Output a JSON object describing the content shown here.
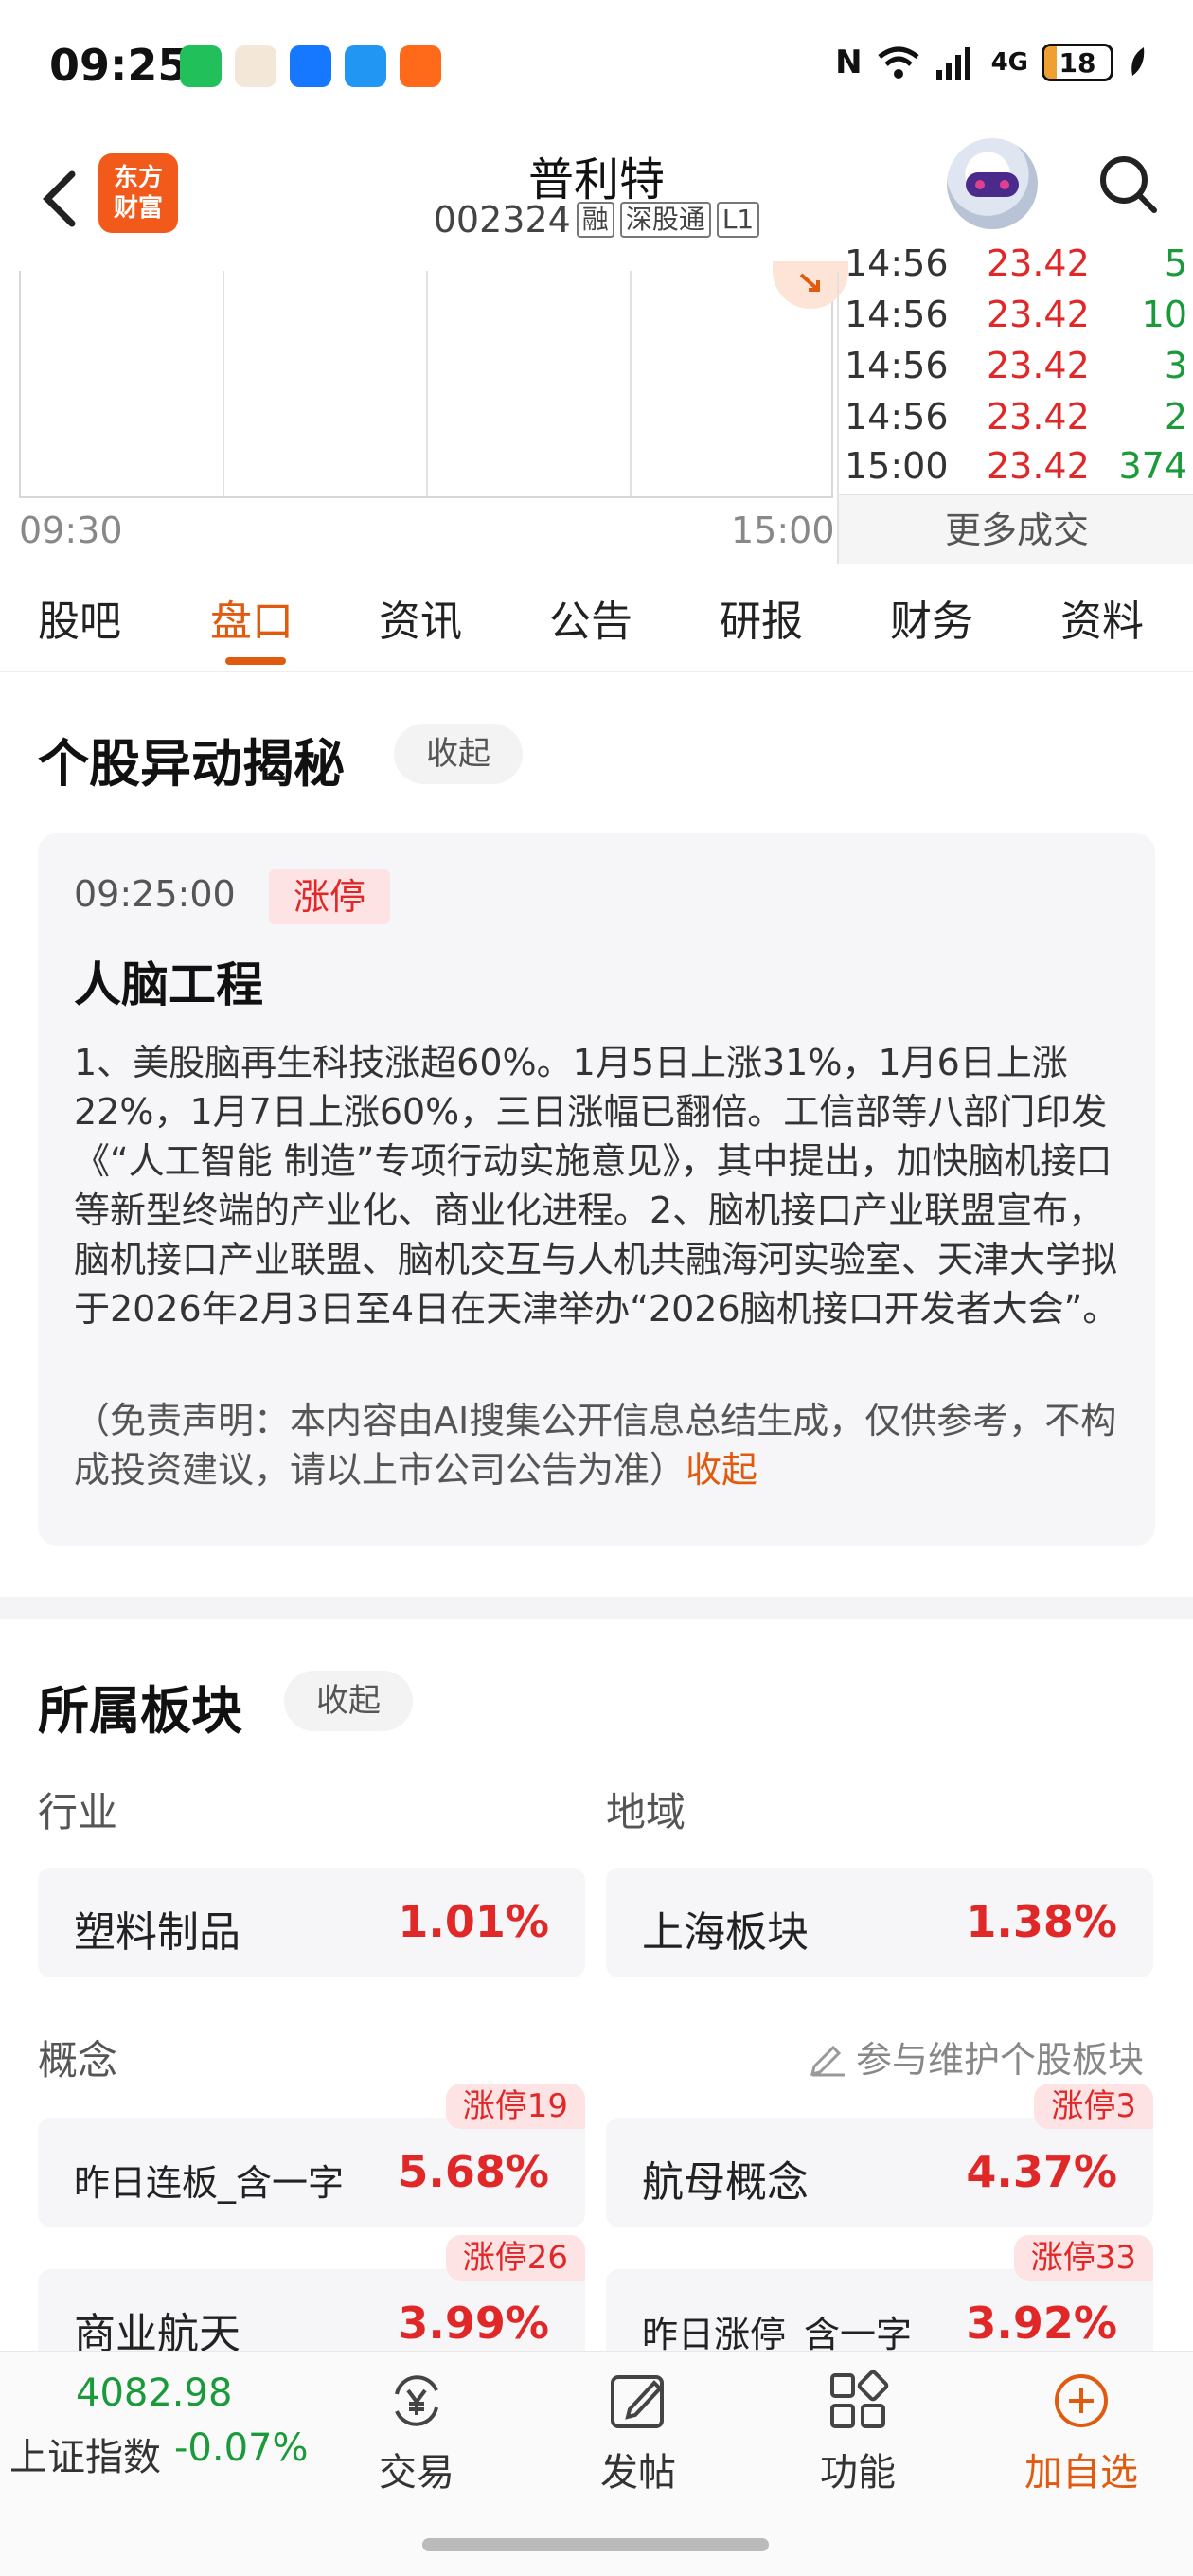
{
  "status_bar": {
    "time": "09:25",
    "battery": "18",
    "network": "4G",
    "battery_level": 0.18
  },
  "header": {
    "logo_text": [
      "东方",
      "财富"
    ],
    "stock_name": "普利特",
    "stock_code": "002324",
    "tags": [
      "融",
      "深股通",
      "L1"
    ]
  },
  "chart": {
    "start_label": "09:30",
    "end_label": "15:00"
  },
  "trades": {
    "rows": [
      {
        "time": "14:56",
        "price": "23.42",
        "volume": "5"
      },
      {
        "time": "14:56",
        "price": "23.42",
        "volume": "10"
      },
      {
        "time": "14:56",
        "price": "23.42",
        "volume": "3"
      },
      {
        "time": "14:56",
        "price": "23.42",
        "volume": "2"
      },
      {
        "time": "15:00",
        "price": "23.42",
        "volume": "374"
      }
    ],
    "more_label": "更多成交"
  },
  "tabs": [
    {
      "label": "股吧"
    },
    {
      "label": "盘口"
    },
    {
      "label": "资讯"
    },
    {
      "label": "公告"
    },
    {
      "label": "研报"
    },
    {
      "label": "财务"
    },
    {
      "label": "资料"
    }
  ],
  "active_tab": "盘口",
  "anomaly": {
    "title": "个股异动揭秘",
    "collapse_label": "收起",
    "time": "09:25:00",
    "tag": "涨停",
    "headline": "人脑工程",
    "body": "1、美股脑再生科技涨超60%。1月5日上涨31%，1月6日上涨22%，1月7日上涨60%，三日涨幅已翻倍。工信部等八部门印发《“人工智能 制造”专项行动实施意见》，其中提出，加快脑机接口等新型终端的产业化、商业化进程。2、脑机接口产业联盟宣布，脑机接口产业联盟、脑机交互与人机共融海河实验室、天津大学拟于2026年2月3日至4日在天津举办“2026脑机接口开发者大会”。",
    "disclaimer": "（免责声明：本内容由AI搜集公开信息总结生成，仅供参考，不构成投资建议，请以上市公司公告为准）",
    "disclaimer_collapse": "收起"
  },
  "sectors": {
    "title": "所属板块",
    "collapse_label": "收起",
    "industry_label": "行业",
    "region_label": "地域",
    "industry": {
      "name": "塑料制品",
      "pct": "1.01%"
    },
    "region": {
      "name": "上海板块",
      "pct": "1.38%"
    },
    "concept_label": "概念",
    "maintain_label": "参与维护个股板块",
    "concepts": [
      {
        "name": "昨日连板_含一字",
        "pct": "5.68%",
        "badge": "涨停19"
      },
      {
        "name": "航母概念",
        "pct": "4.37%",
        "badge": "涨停3"
      },
      {
        "name": "商业航天",
        "pct": "3.99%",
        "badge": "涨停26"
      },
      {
        "name": "昨日涨停_含一字",
        "pct": "3.92%",
        "badge": "涨停33"
      }
    ]
  },
  "bottom_bar": {
    "index_value": "4082.98",
    "index_name": "上证指数",
    "index_change": "-0.07%",
    "nav": [
      {
        "label": "交易",
        "icon": "yen-cycle-icon"
      },
      {
        "label": "发帖",
        "icon": "compose-icon"
      },
      {
        "label": "功能",
        "icon": "grid-icon"
      },
      {
        "label": "加自选",
        "icon": "plus-circle-icon"
      }
    ]
  },
  "colors": {
    "accent": "#e05a10",
    "up": "#e02828",
    "down": "#1a9a3a"
  }
}
